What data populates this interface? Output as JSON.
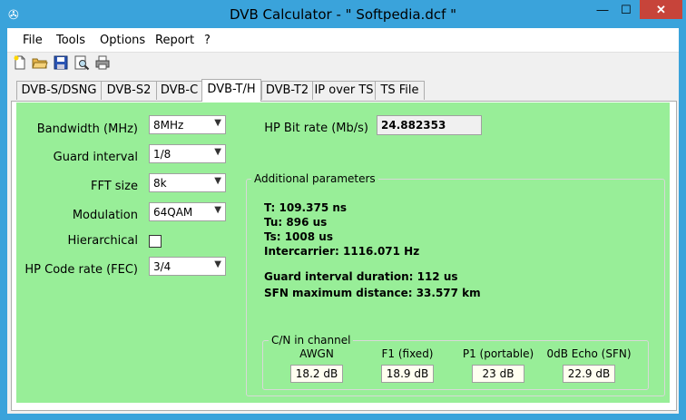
{
  "window": {
    "title": "DVB Calculator -  \" Softpedia.dcf \"",
    "accent": "#3aa3db",
    "close_color": "#c7443a"
  },
  "menu": [
    "File",
    "Tools",
    "Options",
    "Report",
    "?"
  ],
  "toolbar": [
    "new-icon",
    "open-icon",
    "save-icon",
    "print-preview-icon",
    "print-icon"
  ],
  "tabs": [
    "DVB-S/DSNG",
    "DVB-S2",
    "DVB-C",
    "DVB-T/H",
    "DVB-T2",
    "IP over TS",
    "TS File"
  ],
  "active_tab": "DVB-T/H",
  "panel_color": "#98ee98",
  "params": {
    "bandwidth": {
      "label": "Bandwidth (MHz)",
      "value": "8MHz"
    },
    "guard": {
      "label": "Guard interval",
      "value": "1/8"
    },
    "fft": {
      "label": "FFT size",
      "value": "8k"
    },
    "modulation": {
      "label": "Modulation",
      "value": "64QAM"
    },
    "hierarchical": {
      "label": "Hierarchical",
      "checked": false
    },
    "hp_code": {
      "label": "HP Code rate (FEC)",
      "value": "3/4"
    }
  },
  "hp_bitrate": {
    "label": "HP Bit rate (Mb/s)",
    "value": "24.882353"
  },
  "additional": {
    "title": "Additional parameters",
    "t": "T: 109.375 ns",
    "tu": "Tu: 896 us",
    "ts": "Ts: 1008 us",
    "intercarrier": "Intercarrier: 1116.071 Hz",
    "guard_duration": "Guard interval duration: 112 us",
    "sfn": "SFN maximum distance: 33.577 km"
  },
  "cn": {
    "title": "C/N in channel",
    "headers": [
      "AWGN",
      "F1 (fixed)",
      "P1 (portable)",
      "0dB Echo (SFN)"
    ],
    "values": [
      "18.2 dB",
      "18.9 dB",
      "23 dB",
      "22.9 dB"
    ]
  }
}
